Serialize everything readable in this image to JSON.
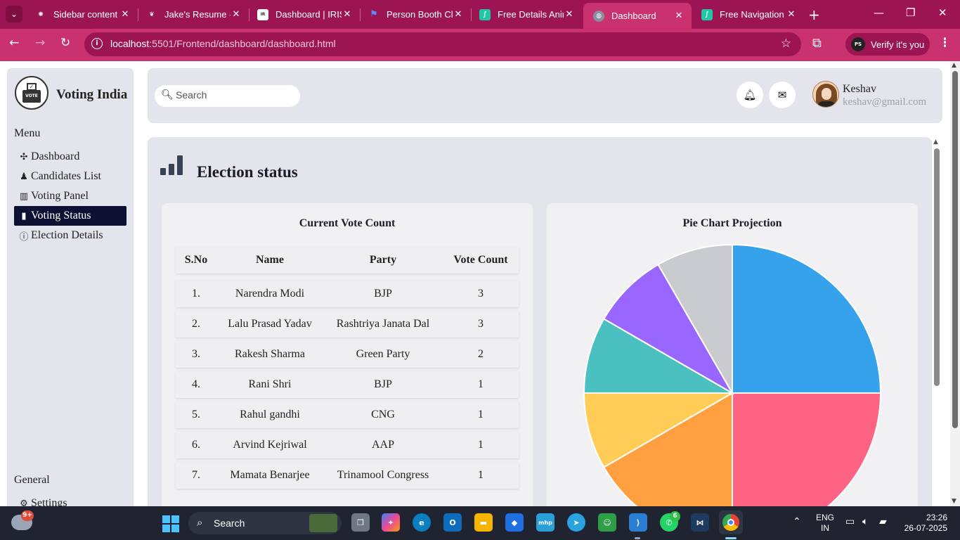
{
  "browser": {
    "tabs": [
      {
        "title": "Sidebar content",
        "favicon": "openai-icon",
        "color": "#9c1552"
      },
      {
        "title": "Jake's Resume -",
        "favicon": "overleaf-icon",
        "color": "#9c1552"
      },
      {
        "title": "Dashboard | IRIS",
        "favicon": "iris-icon",
        "color": "#ffffff"
      },
      {
        "title": "Person Booth Cl",
        "favicon": "flag-icon",
        "color": "#2f6fd6"
      },
      {
        "title": "Free Details Anim",
        "favicon": "lottie-icon",
        "color": "#1fc7a3"
      },
      {
        "title": "Dashboard",
        "favicon": "globe-icon",
        "color": "#8a8fa0",
        "active": true
      },
      {
        "title": "Free Navigation",
        "favicon": "lottie-icon",
        "color": "#1fc7a3"
      }
    ],
    "url_host": "localhost",
    "url_rest": ":5501/Frontend/dashboard/dashboard.html",
    "verify_label": "Verify it's you",
    "profile_initials": "PS"
  },
  "sidebar": {
    "brand": "Voting India",
    "logo_text": "VOTE",
    "menu_label": "Menu",
    "menu": [
      {
        "label": "Dashboard",
        "icon": "slack-grid-icon",
        "glyph": "✣"
      },
      {
        "label": "Candidates List",
        "icon": "person-icon",
        "glyph": "♟"
      },
      {
        "label": "Voting Panel",
        "icon": "voting-panel-icon",
        "glyph": "▥"
      },
      {
        "label": "Voting Status",
        "icon": "bar-chart-icon",
        "glyph": "▮",
        "active": true
      },
      {
        "label": "Election Details",
        "icon": "info-icon",
        "glyph": "ⓘ"
      }
    ],
    "general_label": "General",
    "general": [
      {
        "label": "Settings",
        "icon": "gear-icon",
        "glyph": "⚙"
      }
    ]
  },
  "header": {
    "search_placeholder": "Search",
    "user_name": "Keshav",
    "user_email": "keshav@gmail.com"
  },
  "main": {
    "title": "Election status",
    "table_title": "Current Vote Count",
    "columns": [
      "S.No",
      "Name",
      "Party",
      "Vote Count"
    ],
    "rows": [
      [
        "1.",
        "Narendra Modi",
        "BJP",
        "3"
      ],
      [
        "2.",
        "Lalu Prasad Yadav",
        "Rashtriya Janata Dal",
        "3"
      ],
      [
        "3.",
        "Rakesh Sharma",
        "Green Party",
        "2"
      ],
      [
        "4.",
        "Rani Shri",
        "BJP",
        "1"
      ],
      [
        "5.",
        "Rahul gandhi",
        "CNG",
        "1"
      ],
      [
        "6.",
        "Arvind Kejriwal",
        "AAP",
        "1"
      ],
      [
        "7.",
        "Mamata Benarjee",
        "Trinamool Congress",
        "1"
      ]
    ],
    "pie_title": "Pie Chart Projection"
  },
  "chart_data": {
    "type": "pie",
    "title": "Pie Chart Projection",
    "categories": [
      "Narendra Modi",
      "Lalu Prasad Yadav",
      "Rakesh Sharma",
      "Rani Shri",
      "Rahul gandhi",
      "Arvind Kejriwal",
      "Mamata Benarjee"
    ],
    "values": [
      3,
      3,
      2,
      1,
      1,
      1,
      1
    ],
    "colors": [
      "#36a2eb",
      "#ff6384",
      "#ff9f40",
      "#ffcd56",
      "#4bc0c0",
      "#9966ff",
      "#c9cbcf"
    ]
  },
  "taskbar": {
    "search_label": "Search",
    "weather_badge": "9+",
    "whatsapp_badge": "6",
    "lang_line1": "ENG",
    "lang_line2": "IN",
    "time": "23:26",
    "date": "26-07-2025"
  }
}
